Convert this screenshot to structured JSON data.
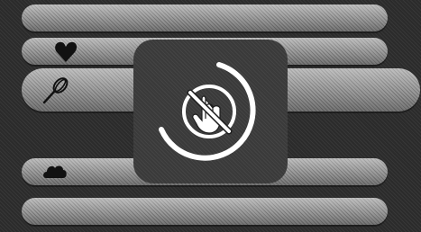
{
  "screen": {
    "icons": {
      "row2": "heart-icon",
      "row3": "whisk-icon",
      "row5": "cloud-icon"
    }
  },
  "overlay": {
    "icon": "no-touch-icon",
    "spinner": "loading-ring"
  },
  "colors": {
    "background": "#2b2b2b",
    "shelf": "#9a9a9a",
    "overlay": "#3a3a3a",
    "spinner": "#ffffff"
  }
}
